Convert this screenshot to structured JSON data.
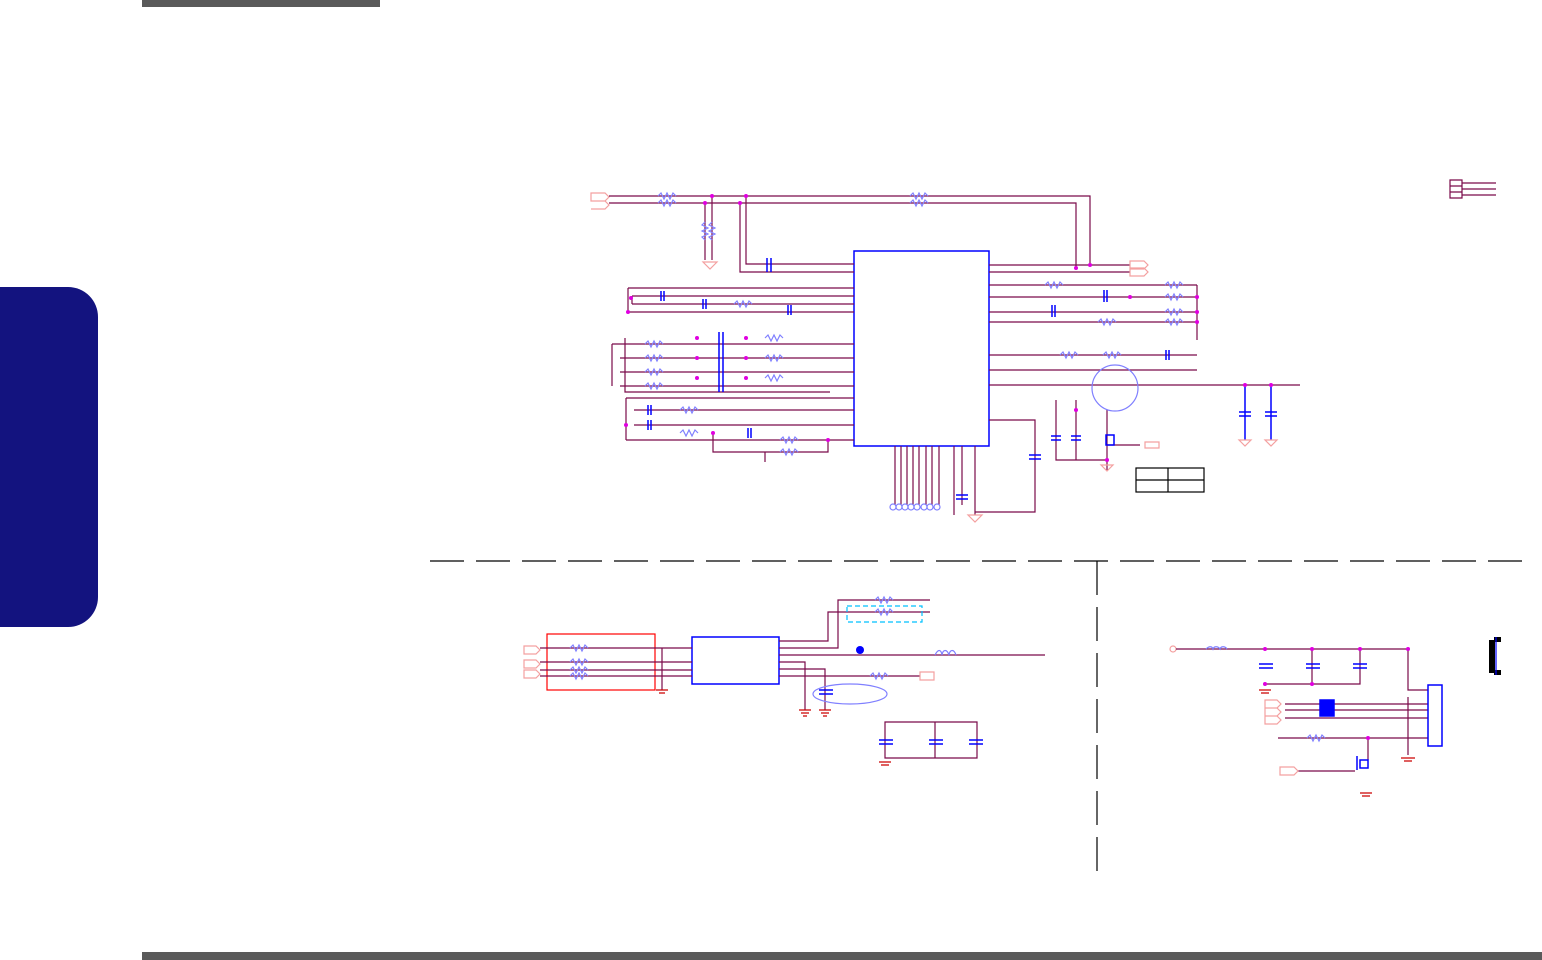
{
  "colors": {
    "page_bar": "#5a5a5a",
    "side_tab": "#13137f",
    "wire": "#7a0a4a",
    "pin": "#ff0000",
    "component": "#0000ff",
    "junction": "#e000e0",
    "port": "#f4a0a0"
  },
  "sections": [
    {
      "name": "main-ic-circuit"
    },
    {
      "name": "lower-left-circuit"
    },
    {
      "name": "lower-right-connector-circuit"
    }
  ]
}
